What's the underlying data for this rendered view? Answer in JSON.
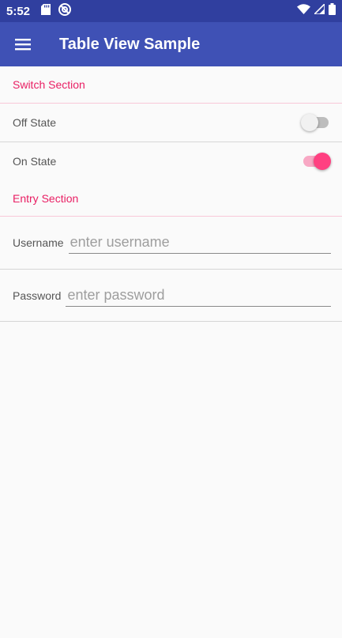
{
  "status_bar": {
    "time": "5:52",
    "icons": [
      "sd-card-icon",
      "sync-icon",
      "wifi-icon",
      "signal-icon",
      "battery-icon"
    ]
  },
  "app_bar": {
    "title": "Table View Sample",
    "menu_icon": "hamburger-menu-icon"
  },
  "colors": {
    "status_bar": "#303f9f",
    "app_bar": "#3f51b5",
    "accent": "#e91e63",
    "switch_on": "#ff4081"
  },
  "sections": {
    "switch_section": {
      "title": "Switch Section",
      "rows": [
        {
          "label": "Off State",
          "on": false
        },
        {
          "label": "On State",
          "on": true
        }
      ]
    },
    "entry_section": {
      "title": "Entry Section",
      "rows": [
        {
          "label": "Username",
          "value": "",
          "placeholder": "enter username"
        },
        {
          "label": "Password",
          "value": "",
          "placeholder": "enter password"
        }
      ]
    }
  }
}
